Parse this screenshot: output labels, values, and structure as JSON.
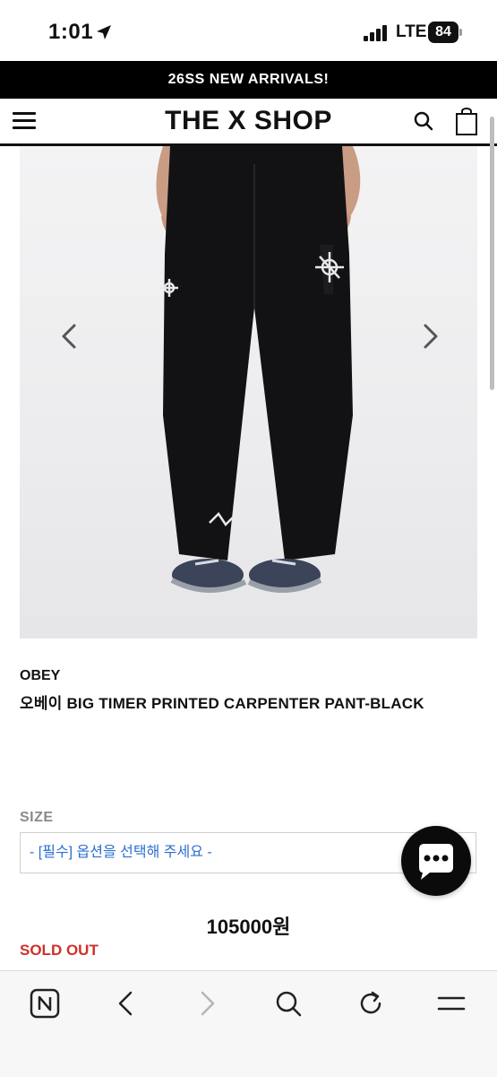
{
  "status_bar": {
    "time": "1:01",
    "network": "LTE",
    "battery": "84"
  },
  "announcement": {
    "text": "26SS NEW ARRIVALS!"
  },
  "header": {
    "brand": "THE X SHOP"
  },
  "icons": {
    "menu": "hamburger-menu-icon",
    "search": "search-icon",
    "cart": "shopping-bag-icon",
    "prev": "chevron-left-icon",
    "next": "chevron-right-icon",
    "chat": "chat-bubble-icon"
  },
  "product": {
    "brand": "OBEY",
    "title": "오베이 BIG TIMER PRINTED CARPENTER PANT-BLACK",
    "size_label": "SIZE",
    "size_placeholder": "- [필수] 옵션을 선택해 주세요 -",
    "price": "105000원",
    "status": "SOLD OUT"
  },
  "colors": {
    "accent_blue": "#2a6fd0",
    "sold_out_red": "#d0302a",
    "black": "#000000"
  },
  "browser_toolbar": [
    "naver-icon",
    "back-icon",
    "forward-icon",
    "search-icon",
    "refresh-icon",
    "menu-icon"
  ]
}
